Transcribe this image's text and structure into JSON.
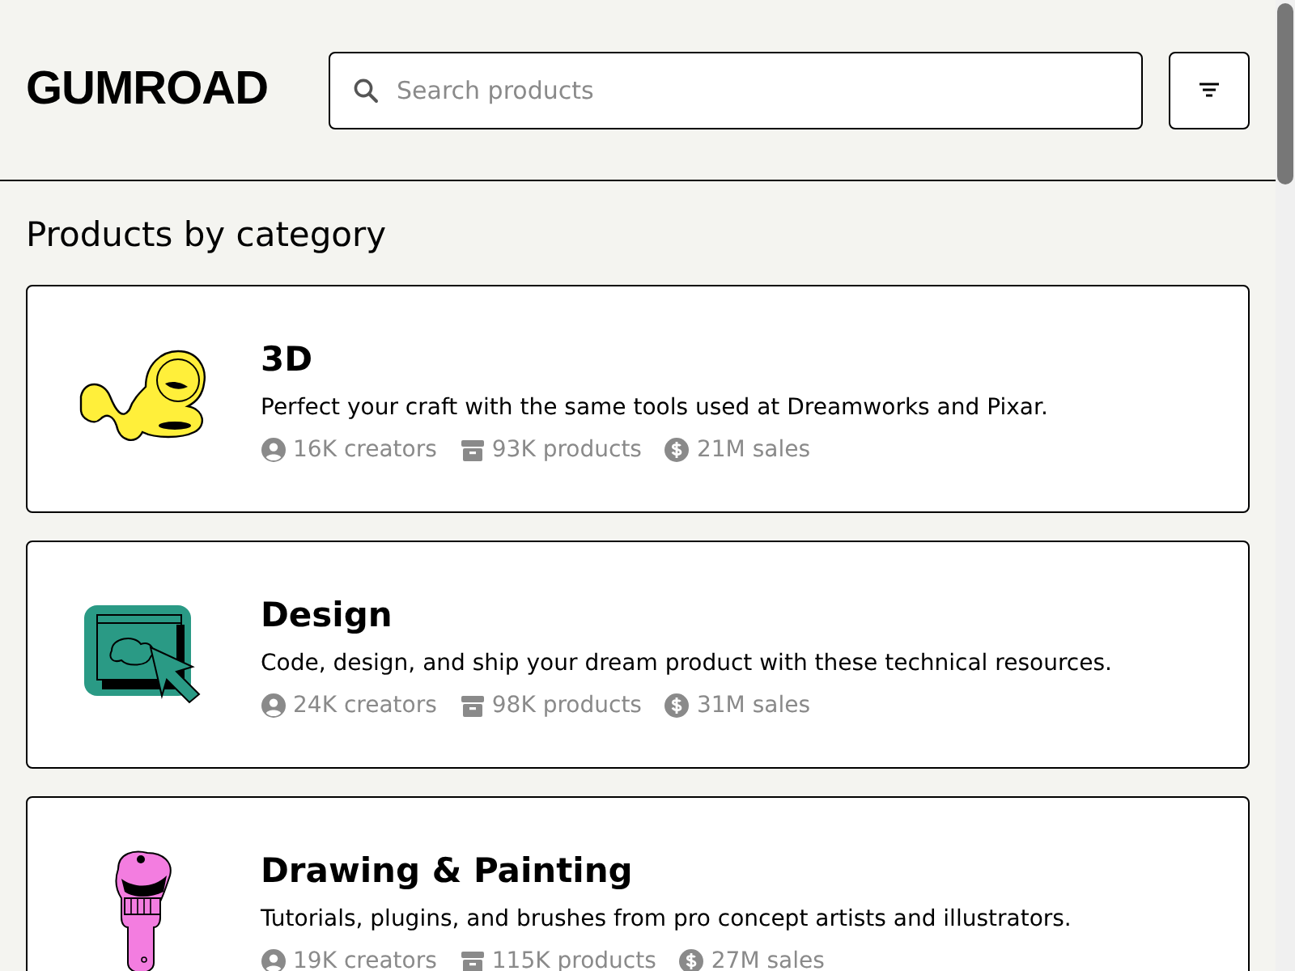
{
  "header": {
    "logo": "GUMROAD",
    "search": {
      "placeholder": "Search products"
    }
  },
  "heading": "Products by category",
  "categories": [
    {
      "kind": "creature",
      "title": "3D",
      "description": "Perfect your craft with the same tools used at Dreamworks and Pixar.",
      "creators": "16K creators",
      "products": "93K products",
      "sales": "21M sales"
    },
    {
      "kind": "design",
      "title": "Design",
      "description": "Code, design, and ship your dream product with these technical resources.",
      "creators": "24K creators",
      "products": "98K products",
      "sales": "31M sales"
    },
    {
      "kind": "drawing",
      "title": "Drawing & Painting",
      "description": "Tutorials, plugins, and brushes from pro concept artists and illustrators.",
      "creators": "19K creators",
      "products": "115K products",
      "sales": "27M sales"
    }
  ]
}
